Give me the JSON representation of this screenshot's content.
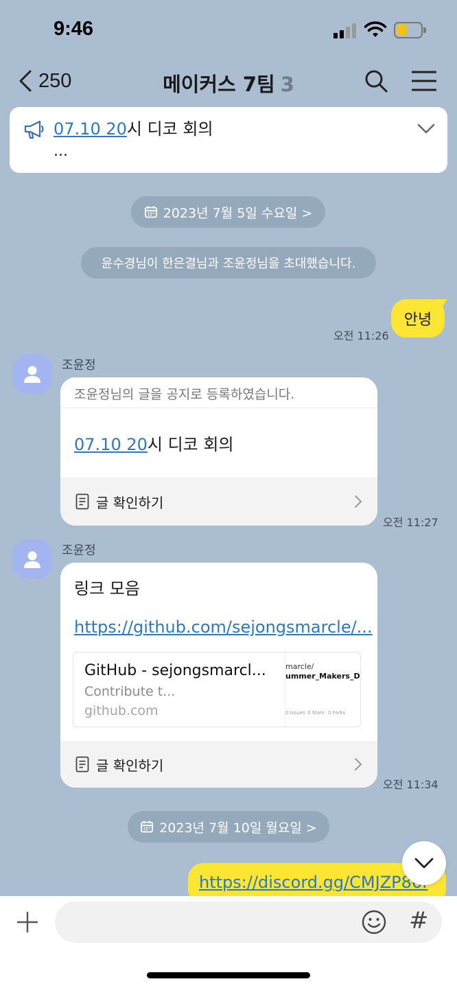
{
  "status_bar": {
    "time": "9:46"
  },
  "header": {
    "back_count": "250",
    "title": "메이커스 7팀",
    "member_count": "3"
  },
  "notice": {
    "link_text": "07.10 20",
    "text_rest": "시 디코 회의",
    "more": "..."
  },
  "messages": {
    "date_1": "2023년 7월 5일 수요일 >",
    "system_1": "윤수경님이 한은결님과 조윤정님을 초대했습니다.",
    "my_msg_1": {
      "text": "안녕",
      "time": "오전 11:26"
    },
    "notice_card": {
      "sender": "조윤정",
      "header": "조윤정님의 글을 공지로 등록하였습니다.",
      "link_text": "07.10 20",
      "text_rest": "시 디코 회의",
      "footer": "글 확인하기",
      "time": "오전 11:27"
    },
    "link_card": {
      "sender": "조윤정",
      "title": "링크 모음",
      "url": "https://github.com/sejongsmarcle/...",
      "preview_title": "GitHub - sejongsmarcl...",
      "preview_desc": "Contribute t...",
      "preview_domain": "github.com",
      "thumb_line1": "marcle/",
      "thumb_line2": "ummer_Makers_D...",
      "thumb_stats": [
        "0 Issues",
        "0 Stars",
        "0 Forks"
      ],
      "footer": "글 확인하기",
      "time": "오전 11:34"
    },
    "date_2": "2023년 7월 10일 월요일 >",
    "my_msg_2": {
      "text": "https://discord.gg/CMJZP86f"
    }
  },
  "colors": {
    "background": "#aabdd1",
    "my_bubble": "#fde633",
    "link": "#2b78c4",
    "pill": "#95a9bd",
    "avatar": "#a3b5f0"
  },
  "icons": [
    "back-chevron-icon",
    "search-icon",
    "menu-icon",
    "megaphone-icon",
    "chevron-down-icon",
    "calendar-icon",
    "person-icon",
    "document-icon",
    "chevron-right-icon",
    "plus-icon",
    "emoji-icon",
    "hash-icon"
  ]
}
